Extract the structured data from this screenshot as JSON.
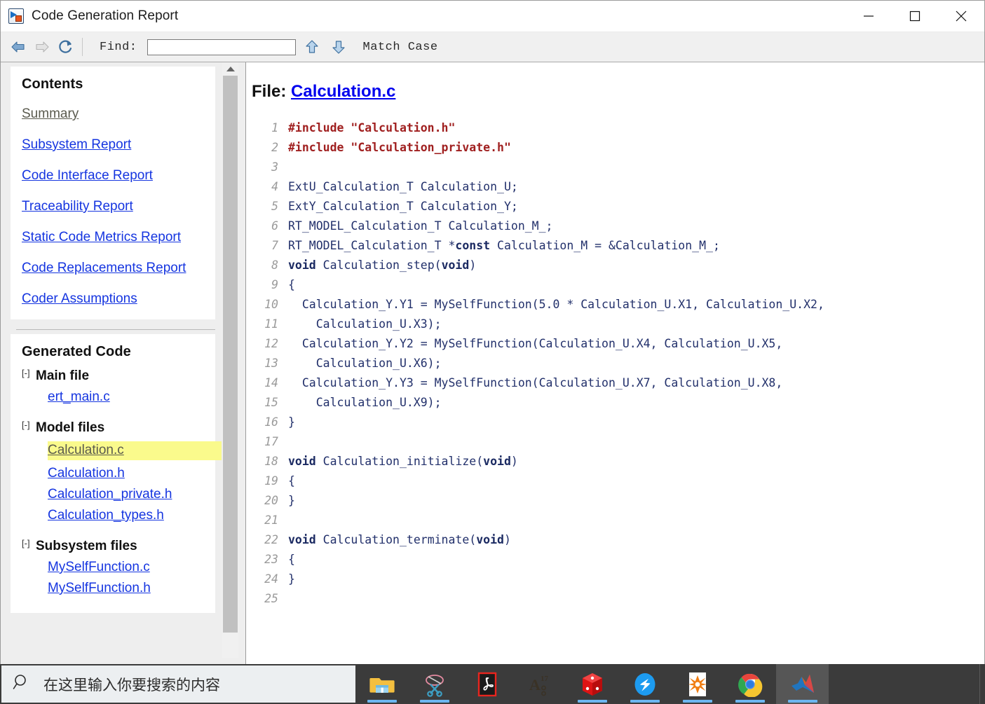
{
  "window": {
    "title": "Code Generation Report",
    "app_icon": "simulink-report-icon",
    "minimize_label": "Minimize",
    "maximize_label": "Maximize",
    "close_label": "Close"
  },
  "toolbar": {
    "back_label": "Back",
    "forward_label": "Forward",
    "refresh_label": "Refresh",
    "find_label": "Find:",
    "find_value": "",
    "find_placeholder": "",
    "find_prev_label": "Find Previous",
    "find_next_label": "Find Next",
    "match_case_label": "Match Case"
  },
  "sidebar": {
    "contents": {
      "heading": "Contents",
      "links": [
        {
          "label": "Summary",
          "visited": true
        },
        {
          "label": "Subsystem Report",
          "visited": false
        },
        {
          "label": "Code Interface Report",
          "visited": false
        },
        {
          "label": "Traceability Report",
          "visited": false
        },
        {
          "label": "Static Code Metrics Report",
          "visited": false
        },
        {
          "label": "Code Replacements Report",
          "visited": false
        },
        {
          "label": "Coder Assumptions",
          "visited": false
        }
      ]
    },
    "generated_code": {
      "heading": "Generated Code",
      "toggle_symbol": "[-]",
      "groups": [
        {
          "label": "Main file",
          "files": [
            {
              "label": "ert_main.c",
              "selected": false
            }
          ]
        },
        {
          "label": "Model files",
          "files": [
            {
              "label": "Calculation.c",
              "selected": true
            },
            {
              "label": "Calculation.h",
              "selected": false
            },
            {
              "label": "Calculation_private.h",
              "selected": false
            },
            {
              "label": "Calculation_types.h",
              "selected": false
            }
          ]
        },
        {
          "label": "Subsystem files",
          "files": [
            {
              "label": "MySelfFunction.c",
              "selected": false
            },
            {
              "label": "MySelfFunction.h",
              "selected": false
            }
          ]
        }
      ]
    },
    "scrollbar": {
      "up_arrow": "scroll-up-arrow"
    }
  },
  "content": {
    "file_prefix": "File:",
    "file_name": "Calculation.c",
    "code_lines": [
      {
        "n": "1",
        "html": "<span class='inc'>#include \"Calculation.h\"</span>"
      },
      {
        "n": "2",
        "html": "<span class='inc'>#include \"Calculation_private.h\"</span>"
      },
      {
        "n": "3",
        "html": ""
      },
      {
        "n": "4",
        "html": "ExtU_Calculation_T Calculation_U;"
      },
      {
        "n": "5",
        "html": "ExtY_Calculation_T Calculation_Y;"
      },
      {
        "n": "6",
        "html": "RT_MODEL_Calculation_T Calculation_M_;"
      },
      {
        "n": "7",
        "html": "RT_MODEL_Calculation_T *<span class='kw'>const</span> Calculation_M = &amp;Calculation_M_;"
      },
      {
        "n": "8",
        "html": "<span class='kw'>void</span> Calculation_step(<span class='kw'>void</span>)"
      },
      {
        "n": "9",
        "html": "{"
      },
      {
        "n": "10",
        "html": "  Calculation_Y.Y1 = MySelfFunction(5.0 * Calculation_U.X1, Calculation_U.X2,"
      },
      {
        "n": "11",
        "html": "    Calculation_U.X3);"
      },
      {
        "n": "12",
        "html": "  Calculation_Y.Y2 = MySelfFunction(Calculation_U.X4, Calculation_U.X5,"
      },
      {
        "n": "13",
        "html": "    Calculation_U.X6);"
      },
      {
        "n": "14",
        "html": "  Calculation_Y.Y3 = MySelfFunction(Calculation_U.X7, Calculation_U.X8,"
      },
      {
        "n": "15",
        "html": "    Calculation_U.X9);"
      },
      {
        "n": "16",
        "html": "}"
      },
      {
        "n": "17",
        "html": ""
      },
      {
        "n": "18",
        "html": "<span class='kw'>void</span> Calculation_initialize(<span class='kw'>void</span>)"
      },
      {
        "n": "19",
        "html": "{"
      },
      {
        "n": "20",
        "html": "}"
      },
      {
        "n": "21",
        "html": ""
      },
      {
        "n": "22",
        "html": "<span class='kw'>void</span> Calculation_terminate(<span class='kw'>void</span>)"
      },
      {
        "n": "23",
        "html": "{"
      },
      {
        "n": "24",
        "html": "}"
      },
      {
        "n": "25",
        "html": ""
      }
    ]
  },
  "taskbar": {
    "search_placeholder": "在这里输入你要搜索的内容",
    "search_icon": "search-icon",
    "items": [
      {
        "name": "file-explorer",
        "running": true,
        "active": false
      },
      {
        "name": "snipping-tool",
        "running": true,
        "active": false
      },
      {
        "name": "adobe-acrobat",
        "running": false,
        "active": false
      },
      {
        "name": "autocad",
        "running": false,
        "active": false
      },
      {
        "name": "solidworks",
        "running": true,
        "active": false
      },
      {
        "name": "dingtalk",
        "running": true,
        "active": false
      },
      {
        "name": "mathematica",
        "running": true,
        "active": false
      },
      {
        "name": "google-chrome",
        "running": true,
        "active": false
      },
      {
        "name": "matlab",
        "running": true,
        "active": true
      }
    ]
  },
  "colors": {
    "link": "#1535e0",
    "visited_link": "#5a5a4e",
    "highlight": "#fafa8c",
    "code_text": "#22306b",
    "include_red": "#a02020",
    "taskbar_bg": "#3b3b3b",
    "running_indicator": "#6cb6f0"
  }
}
